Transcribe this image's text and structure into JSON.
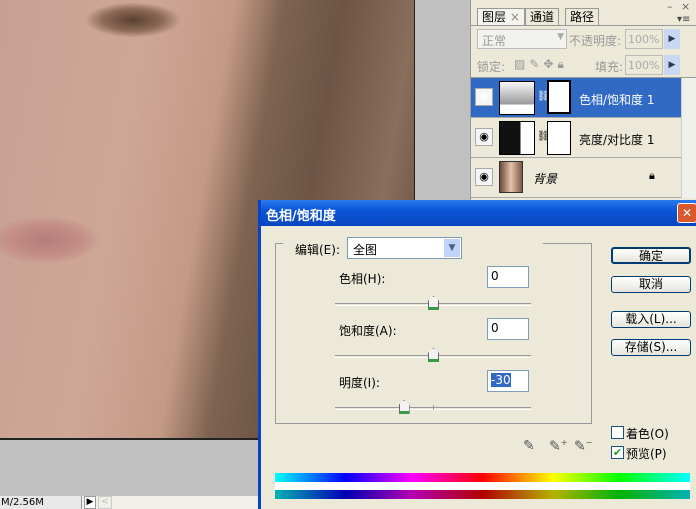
{
  "status_bar": {
    "doc_size": "M/2.56M",
    "arrow": "▶",
    "scroll": "<"
  },
  "layers_panel": {
    "tabs": [
      {
        "label": "图层",
        "close": "×"
      },
      {
        "label": "通道"
      },
      {
        "label": "路径"
      }
    ],
    "window_controls": {
      "minimize": "–",
      "close": "×",
      "menu": "▾≡"
    },
    "blend_mode": "正常",
    "opacity_label": "不透明度:",
    "opacity_value": "100%",
    "lock_label": "锁定:",
    "fill_label": "填充:",
    "fill_value": "100%",
    "layers": [
      {
        "name": "色相/饱和度 1",
        "selected": true
      },
      {
        "name": "亮度/对比度 1",
        "selected": false
      },
      {
        "name": "背景",
        "selected": false,
        "locked": true
      }
    ]
  },
  "dialog": {
    "title": "色相/饱和度",
    "close": "✕",
    "edit_label": "编辑(E):",
    "edit_value": "全图",
    "hue_label": "色相(H):",
    "hue_value": "0",
    "hue_fraction": 0.5,
    "saturation_label": "饱和度(A):",
    "saturation_value": "0",
    "saturation_fraction": 0.5,
    "lightness_label": "明度(I):",
    "lightness_value": "-30",
    "lightness_fraction": 0.35,
    "buttons": {
      "ok": "确定",
      "cancel": "取消",
      "load": "载入(L)...",
      "save": "存储(S)..."
    },
    "colorize_label": "着色(O)",
    "colorize_checked": false,
    "preview_label": "预览(P)",
    "preview_checked": true
  }
}
